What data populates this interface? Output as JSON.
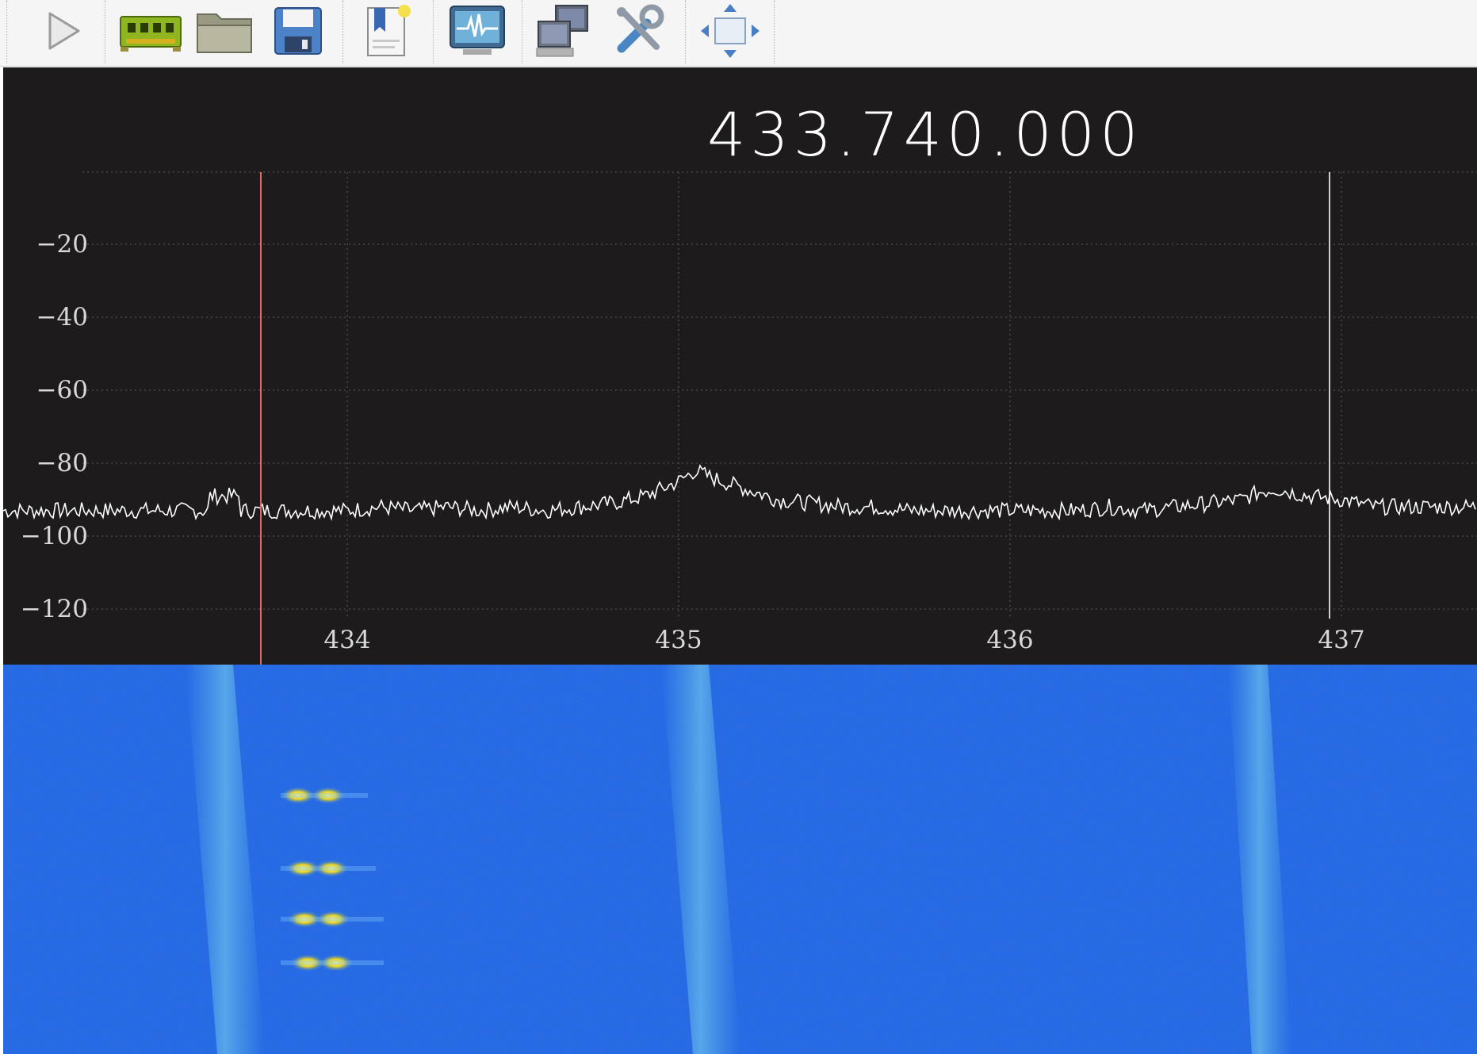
{
  "toolbar": {
    "buttons": [
      {
        "name": "start-button",
        "icon": "play-icon"
      },
      {
        "name": "device-button",
        "icon": "device-board-icon"
      },
      {
        "name": "open-file-button",
        "icon": "folder-icon"
      },
      {
        "name": "save-button",
        "icon": "floppy-disk-icon"
      },
      {
        "name": "bookmark-button",
        "icon": "bookmark-icon"
      },
      {
        "name": "fft-settings-button",
        "icon": "waveform-monitor-icon"
      },
      {
        "name": "remote-control-button",
        "icon": "network-computer-icon"
      },
      {
        "name": "settings-button",
        "icon": "tools-icon"
      },
      {
        "name": "fullscreen-button",
        "icon": "move-arrows-icon"
      }
    ]
  },
  "receiver": {
    "frequency_display": "433.740.000"
  },
  "chart_data": {
    "type": "line",
    "title": "",
    "xlabel": "",
    "ylabel": "",
    "x_ticks": [
      "434",
      "435",
      "436",
      "437"
    ],
    "y_ticks": [
      "-20",
      "-40",
      "-60",
      "-80",
      "-100",
      "-120"
    ],
    "xlim": [
      433.74,
      437.4
    ],
    "ylim": [
      -125,
      0
    ],
    "grid": true,
    "tuned_frequency_marker": 433.74,
    "secondary_marker": 437.0,
    "series": [
      {
        "points": [
          [
            433.74,
            -93
          ],
          [
            433.9,
            -93
          ],
          [
            434.0,
            -93
          ],
          [
            434.1,
            -92
          ],
          [
            434.2,
            -93
          ],
          [
            434.3,
            -92
          ],
          [
            434.4,
            -93
          ],
          [
            434.5,
            -92
          ],
          [
            434.6,
            -93
          ],
          [
            434.7,
            -92
          ],
          [
            434.8,
            -91
          ],
          [
            434.9,
            -89
          ],
          [
            435.0,
            -85
          ],
          [
            435.05,
            -82
          ],
          [
            435.1,
            -84
          ],
          [
            435.2,
            -87
          ],
          [
            435.3,
            -90
          ],
          [
            435.4,
            -91
          ],
          [
            435.5,
            -92
          ],
          [
            435.6,
            -92
          ],
          [
            435.7,
            -93
          ],
          [
            435.8,
            -93
          ],
          [
            435.9,
            -93
          ],
          [
            436.0,
            -93
          ],
          [
            436.1,
            -93
          ],
          [
            436.2,
            -93
          ],
          [
            436.3,
            -92
          ],
          [
            436.4,
            -93
          ],
          [
            436.5,
            -92
          ],
          [
            436.6,
            -91
          ],
          [
            436.7,
            -90
          ],
          [
            436.75,
            -88
          ],
          [
            436.8,
            -87
          ],
          [
            436.9,
            -89
          ],
          [
            437.0,
            -90
          ],
          [
            437.1,
            -92
          ],
          [
            437.2,
            -92
          ],
          [
            437.3,
            -92
          ],
          [
            437.4,
            -92
          ]
        ]
      }
    ]
  },
  "colors": {
    "plot_background": "#1d1b1c",
    "grid": "#5a5a5a",
    "trace": "#ffffff",
    "tuned_marker": "#e06b6b",
    "waterfall_base": "#1f5ff0",
    "waterfall_signal": "#f2e233"
  }
}
